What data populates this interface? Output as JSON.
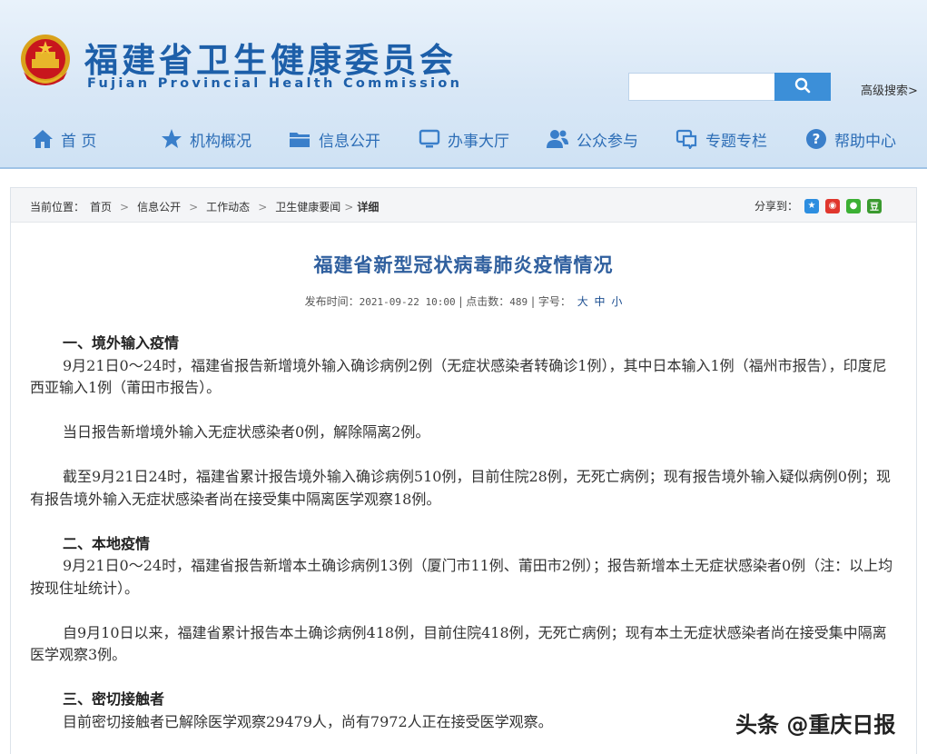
{
  "header": {
    "title": "福建省卫生健康委员会",
    "subtitle": "Fujian Provincial Health Commission",
    "search_placeholder": "",
    "advanced_search": "高级搜索>"
  },
  "nav": {
    "items": [
      {
        "label": "首 页",
        "icon": "home-icon"
      },
      {
        "label": "机构概况",
        "icon": "star-icon"
      },
      {
        "label": "信息公开",
        "icon": "folder-icon"
      },
      {
        "label": "办事大厅",
        "icon": "monitor-icon"
      },
      {
        "label": "公众参与",
        "icon": "users-icon"
      },
      {
        "label": "专题专栏",
        "icon": "chat-icon"
      },
      {
        "label": "帮助中心",
        "icon": "help-icon"
      }
    ]
  },
  "breadcrumb": {
    "prefix": "当前位置：",
    "items": [
      "首页",
      "信息公开",
      "工作动态",
      "卫生健康要闻",
      "详细"
    ]
  },
  "share": {
    "label": "分享到："
  },
  "article": {
    "title": "福建省新型冠状病毒肺炎疫情情况",
    "publish_label": "发布时间：",
    "publish_time": "2021-09-22 10:00",
    "clicks_label": "点击数：",
    "clicks": "489",
    "font_label": "字号：",
    "font_sizes": [
      "大",
      "中",
      "小"
    ],
    "sections": [
      {
        "heading": "一、境外输入疫情",
        "paragraphs": [
          "9月21日0～24时，福建省报告新增境外输入确诊病例2例（无症状感染者转确诊1例），其中日本输入1例（福州市报告），印度尼西亚输入1例（莆田市报告）。",
          "当日报告新增境外输入无症状感染者0例，解除隔离2例。",
          "截至9月21日24时，福建省累计报告境外输入确诊病例510例，目前住院28例，无死亡病例；现有报告境外输入疑似病例0例；现有报告境外输入无症状感染者尚在接受集中隔离医学观察18例。"
        ]
      },
      {
        "heading": "二、本地疫情",
        "paragraphs": [
          "9月21日0～24时，福建省报告新增本土确诊病例13例（厦门市11例、莆田市2例）；报告新增本土无症状感染者0例（注：以上均按现住址统计）。",
          "自9月10日以来，福建省累计报告本土确诊病例418例，目前住院418例，无死亡病例；现有本土无症状感染者尚在接受集中隔离医学观察3例。"
        ]
      },
      {
        "heading": "三、密切接触者",
        "paragraphs": [
          "目前密切接触者已解除医学观察29479人，尚有7972人正在接受医学观察。"
        ]
      }
    ]
  },
  "watermark": "头条 @重庆日报"
}
